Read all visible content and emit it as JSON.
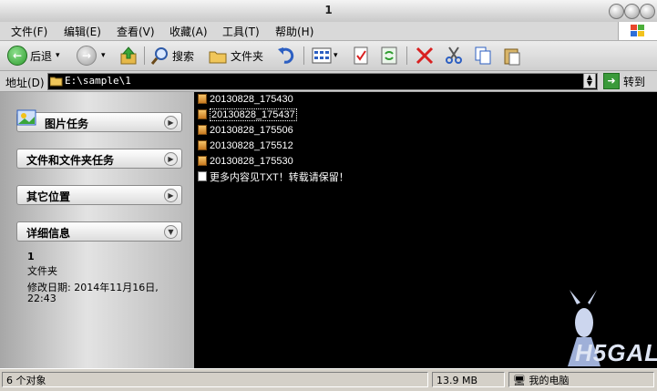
{
  "window": {
    "title": "1"
  },
  "menu": [
    "文件(F)",
    "编辑(E)",
    "查看(V)",
    "收藏(A)",
    "工具(T)",
    "帮助(H)"
  ],
  "toolbar": {
    "back": "后退",
    "search": "搜索",
    "folders": "文件夹"
  },
  "address": {
    "label": "地址(D)",
    "path": "E:\\sample\\1",
    "go": "转到"
  },
  "left_panels": [
    "图片任务",
    "文件和文件夹任务",
    "其它位置",
    "详细信息"
  ],
  "details": {
    "name": "1",
    "type": "文件夹",
    "modified_label": "修改日期: 2014年11月16日,",
    "modified_time": "22:43"
  },
  "files": [
    {
      "name": "20130828_175430",
      "icon": "folder-icon",
      "selected": false
    },
    {
      "name": "20130828_175437",
      "icon": "folder-icon",
      "selected": true
    },
    {
      "name": "20130828_175506",
      "icon": "folder-icon",
      "selected": false
    },
    {
      "name": "20130828_175512",
      "icon": "folder-icon",
      "selected": false
    },
    {
      "name": "20130828_175530",
      "icon": "folder-icon",
      "selected": false
    },
    {
      "name": "更多内容见TXT！转载请保留！",
      "icon": "text-file-icon",
      "selected": false
    }
  ],
  "status": {
    "count": "6 个对象",
    "size": "13.9 MB",
    "location": "我的电脑"
  },
  "watermark": "H5GAL",
  "colors": {
    "explorer_bg": "#000000",
    "go_green": "#3a9a3a",
    "delete_red": "#d92020",
    "back_green": "#2e9c2e"
  }
}
